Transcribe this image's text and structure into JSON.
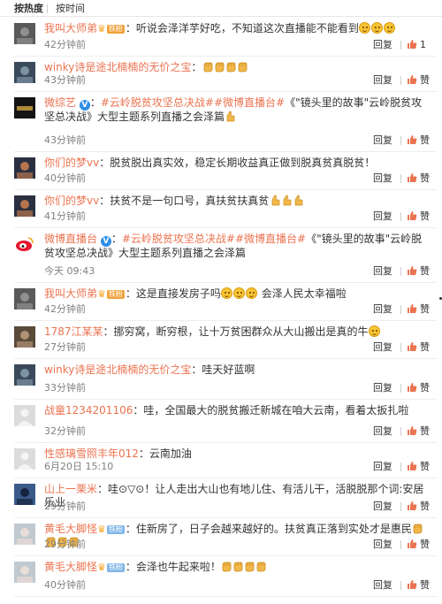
{
  "tabs": [
    {
      "label": "按热度",
      "active": true
    },
    {
      "label": "按时间",
      "active": false
    }
  ],
  "actions": {
    "reply_label": "回复"
  },
  "colors": {
    "username": "#eb7350",
    "topic": "#eb7350",
    "time": "#808080",
    "like_icon": "#eb7350"
  },
  "comments": [
    {
      "user": "我叫大师弟",
      "badge": "铁粉",
      "badge_type": "vip",
      "text": "：听说会泽洋芋好吃，不知道这次直播能不能看到",
      "emojis": 3,
      "emoji_type": "face",
      "time": "42分钟前",
      "likes": "1"
    },
    {
      "user": "winky诗是途北楠楠的无价之宝",
      "text": "：",
      "emojis": 4,
      "emoji_type": "fist",
      "time": "43分钟前",
      "likes": "赞"
    },
    {
      "user": "微综艺",
      "verified": true,
      "text_parts": [
        {
          "t": "：",
          "topic": false
        },
        {
          "t": "#云岭脱贫攻坚总决战#",
          "topic": true
        },
        {
          "t": "#微博直播台#",
          "topic": true
        },
        {
          "t": "《\"镜头里的故事\"云岭脱贫攻坚总决战》大型主题系列直播之会泽篇",
          "topic": false
        }
      ],
      "time": "43分钟前",
      "likes": "赞",
      "avatar_text": "微综艺"
    },
    {
      "user": "你们的梦vv",
      "text": "：脱贫脱出真实效，稳定长期收益真正做到脱真贫真脱贫！",
      "time": "40分钟前",
      "likes": "赞"
    },
    {
      "user": "你们的梦vv",
      "text": "：扶贫不是一句口号，真扶贫扶真贫",
      "emojis": 3,
      "emoji_type": "thumb",
      "time": "41分钟前",
      "likes": "赞"
    },
    {
      "user": "微博直播台",
      "verified": true,
      "text_parts": [
        {
          "t": "：",
          "topic": false
        },
        {
          "t": "#云岭脱贫攻坚总决战#",
          "topic": true
        },
        {
          "t": "#微博直播台#",
          "topic": true
        },
        {
          "t": "《\"镜头里的故事\"云岭脱贫攻坚总决战》大型主题系列直播之会泽篇",
          "topic": false
        }
      ],
      "time": "今天 09:43",
      "likes": "赞"
    },
    {
      "user": "我叫大师弟",
      "badge": "铁粉",
      "badge_type": "vip",
      "text": "：这是直接发房子吗",
      "emojis": 3,
      "emoji_type": "face",
      "text_after": "会泽人民太幸福啦",
      "time": "42分钟前",
      "likes": "赞"
    },
    {
      "user": "1787江某某",
      "text": "：挪穷窝，断穷根，让十万贫困群众从大山搬出是真的牛",
      "time": "27分钟前",
      "likes": "赞"
    },
    {
      "user": "winky诗是途北楠楠的无价之宝",
      "text": "：哇天好蓝啊",
      "time": "33分钟前",
      "likes": "赞"
    },
    {
      "user": "战童1234201106",
      "text": "：哇，全国最大的脱贫搬迁新城在咱大云南，看着太扳扎啦",
      "time": "32分钟前",
      "likes": "赞"
    },
    {
      "user": "性感璃雪照丰年012",
      "text": "：云南加油",
      "time": "6月20日 15:10",
      "likes": "赞"
    },
    {
      "user": "山上一栗米",
      "text": "：哇⊙▽⊙！让人走出大山也有地儿住、有活儿干，活脱脱那个词:安居乐业",
      "time": "29分钟前",
      "likes": "赞"
    },
    {
      "user": "黄毛大脚怪",
      "badge": "铁粉",
      "badge_type": "fan",
      "text": "：住新房了，日子会越来越好的。扶贫真正落到实处才是惠民",
      "emojis": 4,
      "emoji_type": "fist",
      "time": "29分钟前",
      "likes": "赞"
    },
    {
      "user": "黄毛大脚怪",
      "badge": "铁粉",
      "badge_type": "fan",
      "text": "：会泽也牛起来啦！",
      "emojis": 4,
      "emoji_type": "fist",
      "time": "40分钟前",
      "likes": "赞"
    }
  ]
}
